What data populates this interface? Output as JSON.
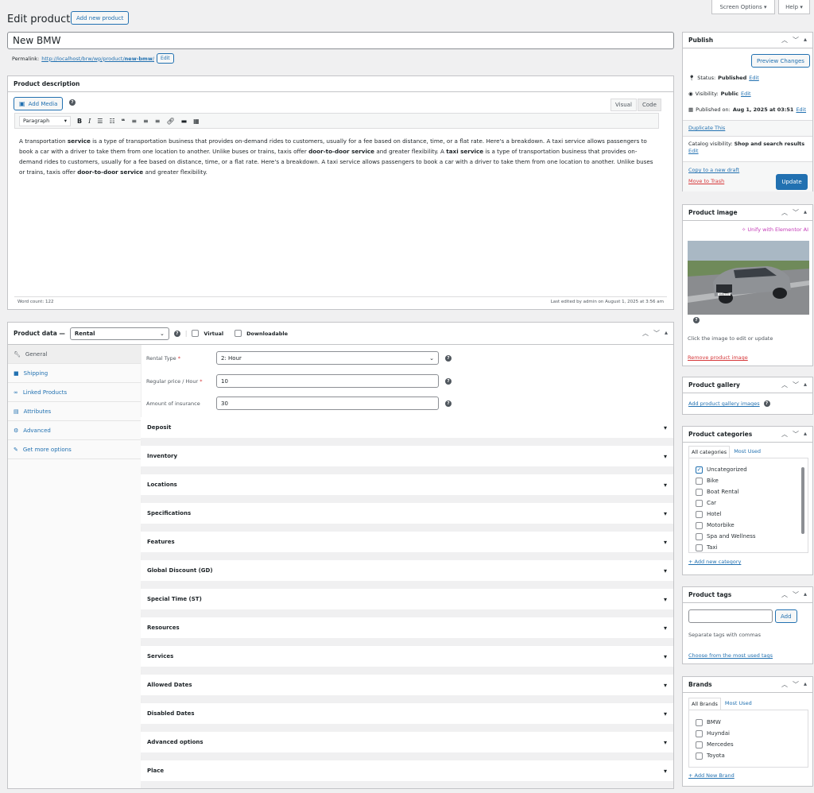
{
  "header": {
    "title": "Edit product",
    "add_new_label": "Add new product",
    "screen_options_label": "Screen Options ▾",
    "help_label": "Help ▾"
  },
  "product": {
    "name": "New BMW",
    "permalink_label": "Permalink:",
    "permalink_url_prefix": "http://localhost/brw/wp/product/",
    "permalink_slug": "new-bmw",
    "permalink_suffix": "/",
    "permalink_edit": "Edit"
  },
  "description": {
    "title": "Product description",
    "add_media_label": "Add Media",
    "tab_visual": "Visual",
    "tab_code": "Code",
    "format_select": "Paragraph",
    "content_html": "A transportation <b>service</b> is a type of transportation business that provides on-demand rides to customers, usually for a fee based on distance, time, or a flat rate. Here's a breakdown. A taxi service allows passengers to book a car with a driver to take them from one location to another. Unlike buses or trains, taxis offer <b>door-to-door service</b> and greater flexibility. A <b>taxi service</b> is a type of transportation business that provides on-demand rides to customers, usually for a fee based on distance, time, or a flat rate. Here's a breakdown. A taxi service allows passengers to book a car with a driver to take them from one location to another. Unlike buses or trains, taxis offer <b>door-to-door service</b> and greater flexibility.",
    "word_count": "Word count: 122",
    "last_edited": "Last edited by admin on August 1, 2025 at 3:56 am"
  },
  "product_data": {
    "label": "Product data —",
    "type_value": "Rental",
    "virtual_label": "Virtual",
    "downloadable_label": "Downloadable",
    "tabs": [
      {
        "label": "General",
        "icon": "wrench-icon"
      },
      {
        "label": "Shipping",
        "icon": "truck-icon"
      },
      {
        "label": "Linked Products",
        "icon": "link-icon"
      },
      {
        "label": "Attributes",
        "icon": "list-icon"
      },
      {
        "label": "Advanced",
        "icon": "gear-icon"
      },
      {
        "label": "Get more options",
        "icon": "plugin-icon"
      }
    ],
    "rental_type_label": "Rental Type",
    "rental_type_value": "2: Hour",
    "regular_price_label": "Regular price / Hour",
    "regular_price_value": "10",
    "insurance_label": "Amount of insurance",
    "insurance_value": "30",
    "required_mark": "*",
    "sections": [
      "Deposit",
      "Inventory",
      "Locations",
      "Specifications",
      "Features",
      "Global Discount (GD)",
      "Special Time (ST)",
      "Resources",
      "Services",
      "Allowed Dates",
      "Disabled Dates",
      "Advanced options",
      "Place"
    ]
  },
  "publish": {
    "title": "Publish",
    "preview_label": "Preview Changes",
    "status_label": "Status:",
    "status_value": "Published",
    "visibility_label": "Visibility:",
    "visibility_value": "Public",
    "published_label": "Published on:",
    "published_value": "Aug 1, 2025 at 03:51",
    "edit_label": "Edit",
    "duplicate_label": "Duplicate This",
    "catalog_label": "Catalog visibility:",
    "catalog_value": "Shop and search results",
    "copy_label": "Copy to a new draft",
    "trash_label": "Move to Trash",
    "update_label": "Update"
  },
  "product_image": {
    "title": "Product image",
    "elementor_label": "✧ Unify with Elementor AI",
    "caption": "Click the image to edit or update",
    "remove_label": "Remove product image",
    "plate_text": "M-AB 7777"
  },
  "gallery": {
    "title": "Product gallery",
    "add_label": "Add product gallery images"
  },
  "categories": {
    "title": "Product categories",
    "tab_all": "All categories",
    "tab_most": "Most Used",
    "items": [
      {
        "label": "Uncategorized",
        "checked": true
      },
      {
        "label": "Bike",
        "checked": false
      },
      {
        "label": "Boat Rental",
        "checked": false
      },
      {
        "label": "Car",
        "checked": false
      },
      {
        "label": "Hotel",
        "checked": false
      },
      {
        "label": "Motorbike",
        "checked": false
      },
      {
        "label": "Spa and Wellness",
        "checked": false
      },
      {
        "label": "Taxi",
        "checked": false
      }
    ],
    "add_label": "+ Add new category"
  },
  "tags": {
    "title": "Product tags",
    "add_button": "Add",
    "hint": "Separate tags with commas",
    "choose_label": "Choose from the most used tags"
  },
  "brands": {
    "title": "Brands",
    "tab_all": "All Brands",
    "tab_most": "Most Used",
    "items": [
      "BMW",
      "Huyndai",
      "Mercedes",
      "Toyota"
    ],
    "add_label": "+ Add New Brand"
  },
  "colors": {
    "accent": "#2271b1",
    "danger": "#d63638",
    "elementor": "#c43ab7"
  }
}
